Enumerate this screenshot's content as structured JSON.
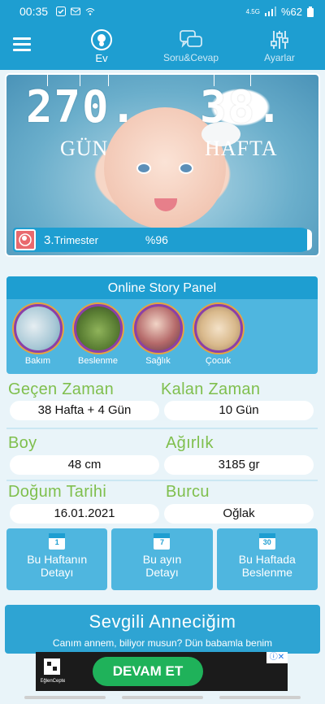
{
  "status": {
    "time": "00:35",
    "network": "4.5G",
    "battery": "%62"
  },
  "nav": {
    "home": "Ev",
    "qa": "Soru&Cevap",
    "settings": "Ayarlar"
  },
  "hero": {
    "days_value": "270.",
    "days_label": "GÜN",
    "weeks_value": "38.",
    "weeks_label": "HAFTA",
    "trimester_num": "3.",
    "trimester_label": "Trimester",
    "progress_text": "%96",
    "progress_fraction": 0.96
  },
  "stories": {
    "title": "Online Story Panel",
    "items": [
      {
        "label": "Bakım"
      },
      {
        "label": "Beslenme"
      },
      {
        "label": "Sağlık"
      },
      {
        "label": "Çocuk"
      }
    ]
  },
  "info": {
    "elapsed_label": "Geçen Zaman",
    "elapsed_value": "38 Hafta + 4 Gün",
    "remaining_label": "Kalan Zaman",
    "remaining_value": "10 Gün",
    "height_label": "Boy",
    "height_value": "48 cm",
    "weight_label": "Ağırlık",
    "weight_value": "3185 gr",
    "birth_label": "Doğum Tarihi",
    "birth_value": "16.01.2021",
    "zodiac_label": "Burcu",
    "zodiac_value": "Oğlak"
  },
  "tiles": [
    {
      "cal": "1",
      "line1": "Bu Haftanın",
      "line2": "Detayı"
    },
    {
      "cal": "7",
      "line1": "Bu ayın",
      "line2": "Detayı"
    },
    {
      "cal": "30",
      "line1": "Bu Haftada",
      "line2": "Beslenme"
    }
  ],
  "letter": {
    "title": "Sevgili Anneciğim",
    "body": "Canım annem, biliyor musun? Dün babamla benim"
  },
  "ad": {
    "button": "DEVAM ET",
    "brand": "EğlenCepte"
  },
  "colors": {
    "primary": "#1e9ed1",
    "tile": "#4fb6df",
    "label_green": "#7fbf4d",
    "ad_button": "#1fb25a"
  }
}
